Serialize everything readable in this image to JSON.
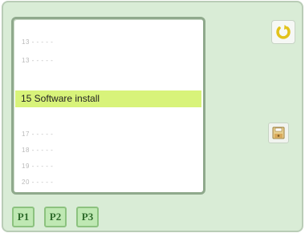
{
  "list": {
    "rows_top": [
      {
        "label": "13 - - - - -"
      },
      {
        "label": "13 - - - - -"
      }
    ],
    "selected": {
      "label": "15 Software install"
    },
    "rows_bottom": [
      {
        "label": "17 - - - - -"
      },
      {
        "label": "18 - - - - -"
      },
      {
        "label": "19 - - - - -"
      },
      {
        "label": "20 - - - - -"
      }
    ]
  },
  "pages": [
    {
      "label": "P1"
    },
    {
      "label": "P2"
    },
    {
      "label": "P3"
    }
  ],
  "icons": {
    "refresh": "refresh-icon",
    "disk": "floppy-disk-icon"
  },
  "colors": {
    "background": "#d9ecd6",
    "highlight": "#d8f37a",
    "page_button": "#bfe8b3",
    "refresh_icon": "#e2c21a"
  }
}
